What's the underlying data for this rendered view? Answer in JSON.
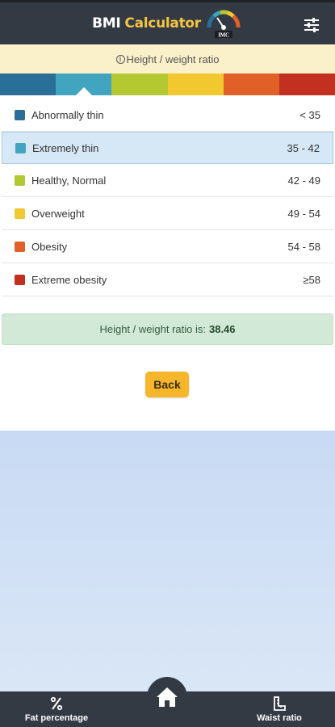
{
  "header": {
    "title_part1": "BMI",
    "title_part2": "Calculator",
    "logo_text": "IMC",
    "logo_icon": "gauge-logo-icon",
    "menu_icon": "sliders-menu-icon"
  },
  "subheader": {
    "info_symbol": "i",
    "text": "Height / weight ratio"
  },
  "colors": {
    "header_bg": "#333a44",
    "accent_title": "#f4c542",
    "back_button": "#f5b62b",
    "result_bg": "#d3e9d8"
  },
  "scale": {
    "selected_index": 1,
    "segments": [
      "#2a6f97",
      "#42a5c0",
      "#b4c832",
      "#f2c830",
      "#e06028",
      "#c2311f"
    ]
  },
  "categories": [
    {
      "label": "Abnormally thin",
      "range": "< 35",
      "color": "#2a6f97"
    },
    {
      "label": "Extremely thin",
      "range": "35 - 42",
      "color": "#42a5c0"
    },
    {
      "label": "Healthy, Normal",
      "range": "42 - 49",
      "color": "#b4c832"
    },
    {
      "label": "Overweight",
      "range": "49 - 54",
      "color": "#f2c830"
    },
    {
      "label": "Obesity",
      "range": "54 - 58",
      "color": "#e06028"
    },
    {
      "label": "Extreme obesity",
      "range": "≥58",
      "color": "#c2311f"
    }
  ],
  "result": {
    "label": "Height / weight ratio is:",
    "value": "38.46"
  },
  "back_button": {
    "label": "Back"
  },
  "bottom_nav": {
    "left_label": "Fat percentage",
    "left_icon": "percent-icon",
    "home_icon": "home-icon",
    "right_label": "Waist ratio",
    "right_icon": "ruler-icon"
  }
}
